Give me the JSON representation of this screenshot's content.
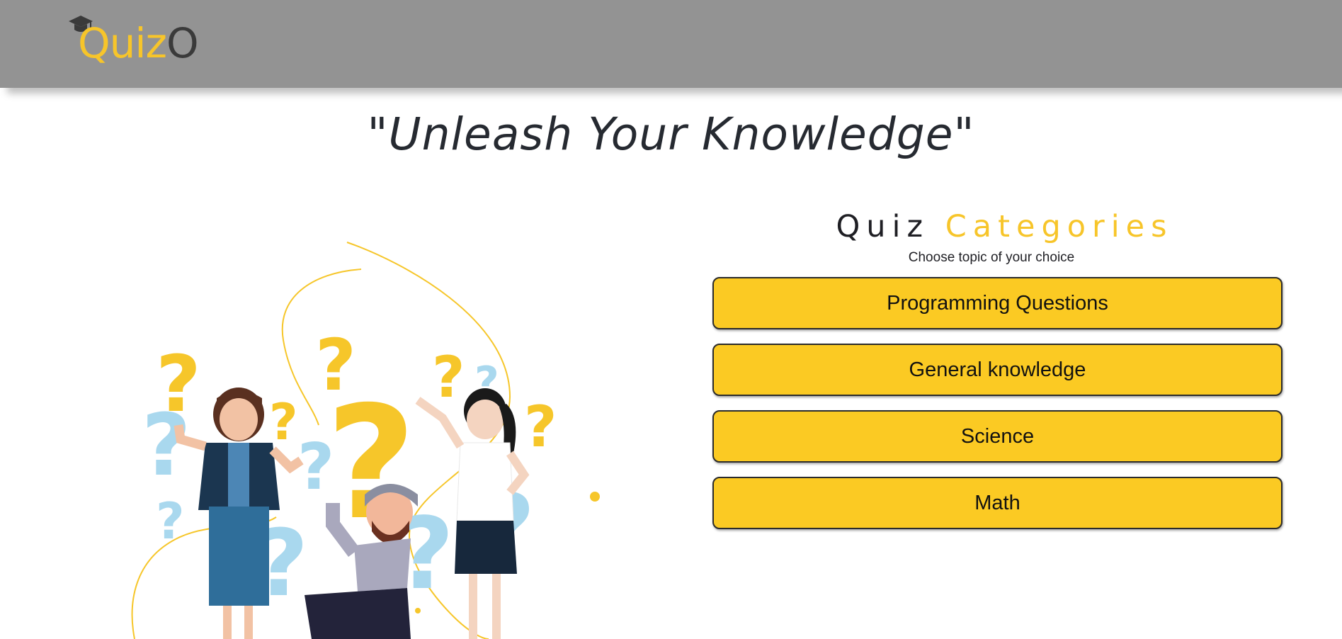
{
  "header": {
    "logo": {
      "text_part1": "Quiz",
      "text_part2": "O",
      "icon": "graduation-cap-icon"
    }
  },
  "tagline": "\"Unleash Your Knowledge\"",
  "categories": {
    "title_part1": "Quiz",
    "title_part2": "Categories",
    "subtitle": "Choose topic of your choice",
    "items": [
      {
        "label": "Programming Questions"
      },
      {
        "label": "General knowledge"
      },
      {
        "label": "Science"
      },
      {
        "label": "Math"
      }
    ]
  },
  "colors": {
    "header_bg": "#939393",
    "accent_yellow": "#fbca23",
    "logo_yellow": "#f7c52a",
    "light_blue": "#a9d8ee",
    "text_dark": "#262a31"
  },
  "illustration": {
    "icon": "people-with-question-marks-illustration"
  }
}
